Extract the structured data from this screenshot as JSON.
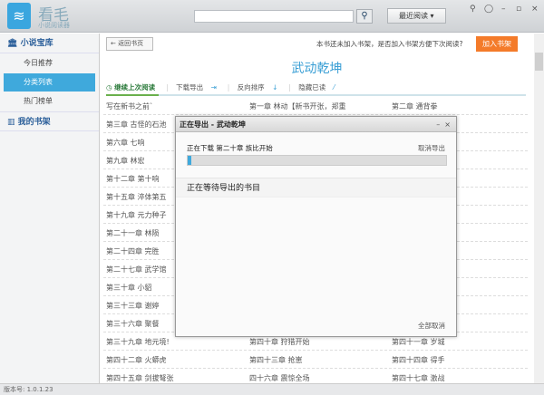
{
  "app": {
    "brand": "看毛",
    "brand_sub": "小说阅读器",
    "recent_label": "最近阅读",
    "search_value": ""
  },
  "sidebar": {
    "library": "小说宝库",
    "items": [
      {
        "label": "今日推荐"
      },
      {
        "label": "分类列表"
      },
      {
        "label": "热门榜单"
      }
    ],
    "shelf": "我的书架"
  },
  "main": {
    "back": "返回书页",
    "notice": "本书还未加入书架，是否加入书架方便下次阅读?",
    "add": "加入书架",
    "title": "武动乾坤",
    "tools": {
      "continue": "继续上次阅读",
      "download": "下载导出",
      "reverse": "反向排序",
      "hide": "隐藏已读"
    },
    "rows": [
      [
        "写在新书之前`",
        "第一章 林动【新书开张，郑重",
        "第二章 通背拳"
      ],
      [
        "第三章 古怪的石池",
        "",
        ""
      ],
      [
        "第六章 七响",
        "",
        ""
      ],
      [
        "第九章 林宏",
        "",
        ""
      ],
      [
        "第十二章 第十响",
        "",
        "之气"
      ],
      [
        "第十五章 淬体第五",
        "",
        ""
      ],
      [
        "第十九章 元力种子",
        "",
        ""
      ],
      [
        "第二十一章 林陨",
        "",
        ""
      ],
      [
        "第二十四章 完胜",
        "",
        ""
      ],
      [
        "第二十七章 武学馆",
        "",
        "故"
      ],
      [
        "第三十章 小貂",
        "",
        "易所"
      ],
      [
        "第三十三章 谢婷",
        "",
        "手"
      ],
      [
        "第三十六章 聚餐",
        "",
        ""
      ],
      [
        "第三十九章 地元境!",
        "第四十章 狩猎开始",
        "第四十一章 岁城"
      ],
      [
        "第四十二章 火蟒虎",
        "第四十三章 抢崽",
        "第四十四章 得手"
      ],
      [
        "第四十五章 剑拔弩张",
        "四十六章 震惊全场",
        "第四十七章 激战"
      ]
    ]
  },
  "dialog": {
    "title": "正在导出 -  武动乾坤",
    "downloading": "正在下载 第二十章 族比开始",
    "cancel": "取消导出",
    "progress_percent": 1,
    "waiting": "正在等待导出的书目",
    "cancel_all": "全部取消"
  },
  "status": {
    "version": "版本号: 1.0.1.23"
  },
  "colors": {
    "accent": "#3fa9dc",
    "add_button": "#f47b2a"
  }
}
